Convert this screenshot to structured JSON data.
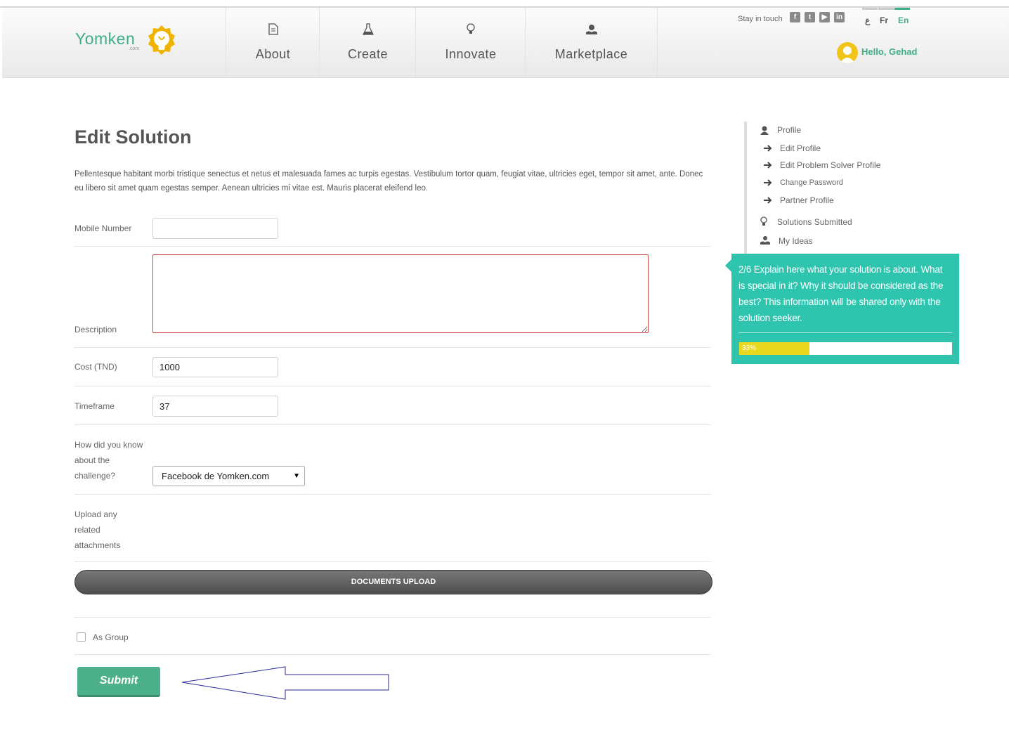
{
  "header": {
    "logo_text": "Yomken",
    "logo_sub": ".com",
    "nav": [
      {
        "label": "About",
        "icon": "document-icon"
      },
      {
        "label": "Create",
        "icon": "flask-icon"
      },
      {
        "label": "Innovate",
        "icon": "lightbulb-icon"
      },
      {
        "label": "Marketplace",
        "icon": "hand-gear-icon"
      }
    ],
    "stay_in_touch": "Stay in touch",
    "social": [
      "facebook-icon",
      "twitter-icon",
      "youtube-icon",
      "linkedin-icon"
    ],
    "languages": [
      "ع",
      "Fr",
      "En"
    ],
    "active_language": "En",
    "greeting": "Hello, Gehad"
  },
  "main": {
    "title": "Edit Solution",
    "intro": "Pellentesque habitant morbi tristique senectus et netus et malesuada fames ac turpis egestas. Vestibulum tortor quam, feugiat vitae, ultricies eget, tempor sit amet, ante. Donec eu libero sit amet quam egestas semper. Aenean ultricies mi vitae est. Mauris placerat eleifend leo.",
    "fields": {
      "mobile": {
        "label": "Mobile Number",
        "value": ""
      },
      "description": {
        "label": "Description",
        "value": ""
      },
      "cost": {
        "label": "Cost (TND)",
        "value": "1000"
      },
      "timeframe": {
        "label": "Timeframe",
        "value": "37"
      },
      "how_did_you_know": {
        "label": "How did you know about the challenge?",
        "selected": "Facebook de Yomken.com"
      },
      "attachments": {
        "label": "Upload any related attachments"
      }
    },
    "upload_button": "DOCUMENTS UPLOAD",
    "as_group": {
      "label": "As Group",
      "checked": false
    },
    "submit": "Submit"
  },
  "sidebar": {
    "profile": "Profile",
    "sub_items": [
      "Edit Profile",
      "Edit Problem Solver Profile",
      "Change Password",
      "Partner Profile"
    ],
    "solutions_submitted": "Solutions Submitted",
    "my_ideas": "My Ideas"
  },
  "tooltip": {
    "text": "2/6 Explain here what your solution is about. What is special in it? Why it should be considered as the best? This information will be shared only with the solution seeker.",
    "progress_label": "33%",
    "progress": 0.33
  },
  "colors": {
    "brand_green": "#3fae86",
    "tooltip_teal": "#2ec4ae",
    "progress_yellow": "#e8d920",
    "error_red": "#d04848"
  }
}
